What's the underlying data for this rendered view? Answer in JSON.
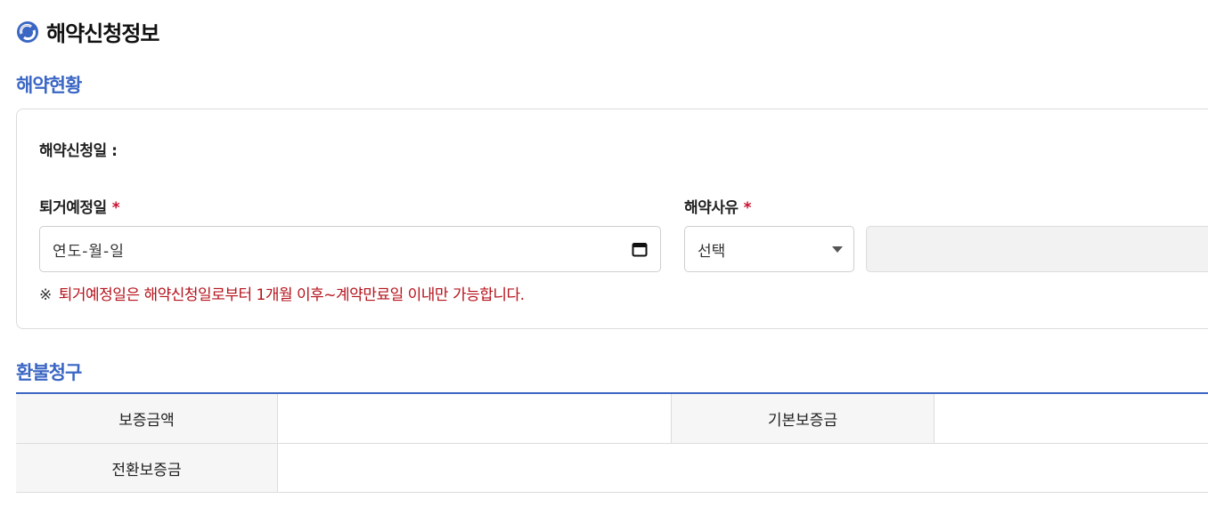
{
  "page": {
    "title": "해약신청정보",
    "logo_icon": "circular-arrow-logo-icon"
  },
  "status_section": {
    "title": "해약현황",
    "apply_date_label": "해약신청일 :",
    "moveout_label": "퇴거예정일",
    "required_mark": "*",
    "date_value": "연도-월-일",
    "date_icon": "calendar-icon",
    "reason_label": "해약사유",
    "reason_select_value": "선택",
    "reason_select_icon": "chevron-down-icon",
    "notice_mark": "※",
    "notice_text": "퇴거예정일은 해약신청일로부터 1개월 이후~계약만료일 이내만 가능합니다."
  },
  "refund_section": {
    "title": "환불청구",
    "rows": [
      {
        "col1_header": "보증금액",
        "col2_header": "기본보증금"
      },
      {
        "col1_header": "전환보증금"
      }
    ]
  },
  "colors": {
    "accent": "#3a66c4",
    "warning": "#b5121b",
    "required": "#c8102e"
  }
}
